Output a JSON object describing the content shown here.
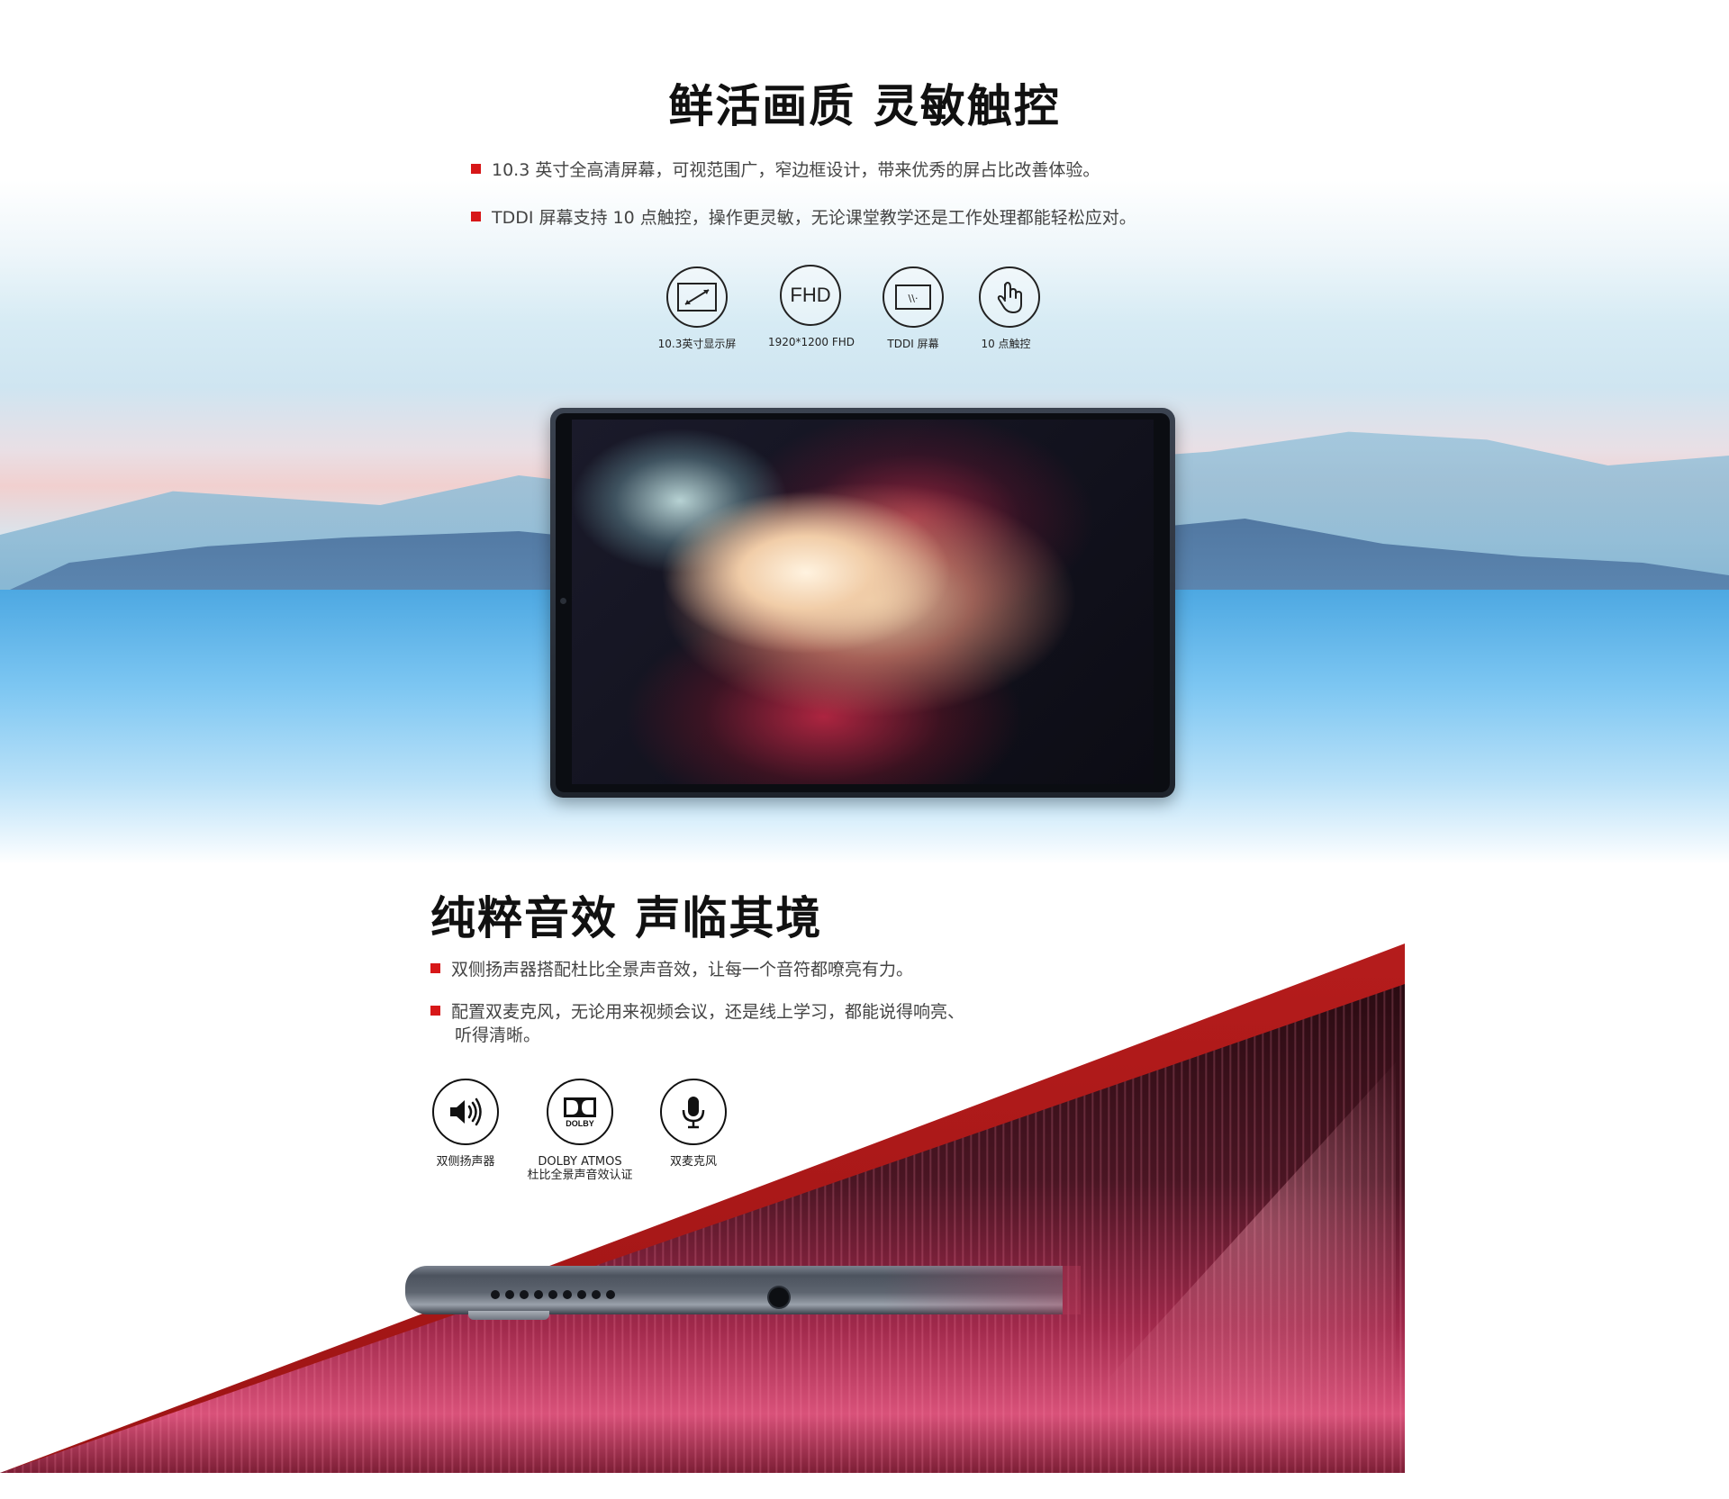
{
  "display": {
    "title": "鲜活画质 灵敏触控",
    "bullets": [
      "10.3 英寸全高清屏幕，可视范围广，窄边框设计，带来优秀的屏占比改善体验。",
      "TDDI 屏幕支持 10 点触控，操作更灵敏，无论课堂教学还是工作处理都能轻松应对。"
    ],
    "features": [
      {
        "icon": "screen-diagonal-icon",
        "label": "10.3英寸显示屏"
      },
      {
        "icon": "fhd-icon",
        "text": "FHD",
        "label": "1920*1200 FHD"
      },
      {
        "icon": "tddi-screen-icon",
        "label": "TDDI 屏幕"
      },
      {
        "icon": "touch-hand-icon",
        "label": "10 点触控"
      }
    ]
  },
  "audio": {
    "title": "纯粹音效 声临其境",
    "bullets": [
      "双侧扬声器搭配杜比全景声音效，让每一个音符都嘹亮有力。",
      "配置双麦克风，无论用来视频会议，还是线上学习，都能说得响亮、听得清晰。"
    ],
    "features": [
      {
        "icon": "speaker-icon",
        "label": "双侧扬声器"
      },
      {
        "icon": "dolby-icon",
        "text": "DOLBY",
        "label": "DOLBY ATMOS",
        "sublabel": "杜比全景声音效认证"
      },
      {
        "icon": "microphone-icon",
        "label": "双麦克风"
      }
    ]
  },
  "colors": {
    "accent": "#d71718",
    "title": "#111111",
    "body_text": "#444444"
  }
}
